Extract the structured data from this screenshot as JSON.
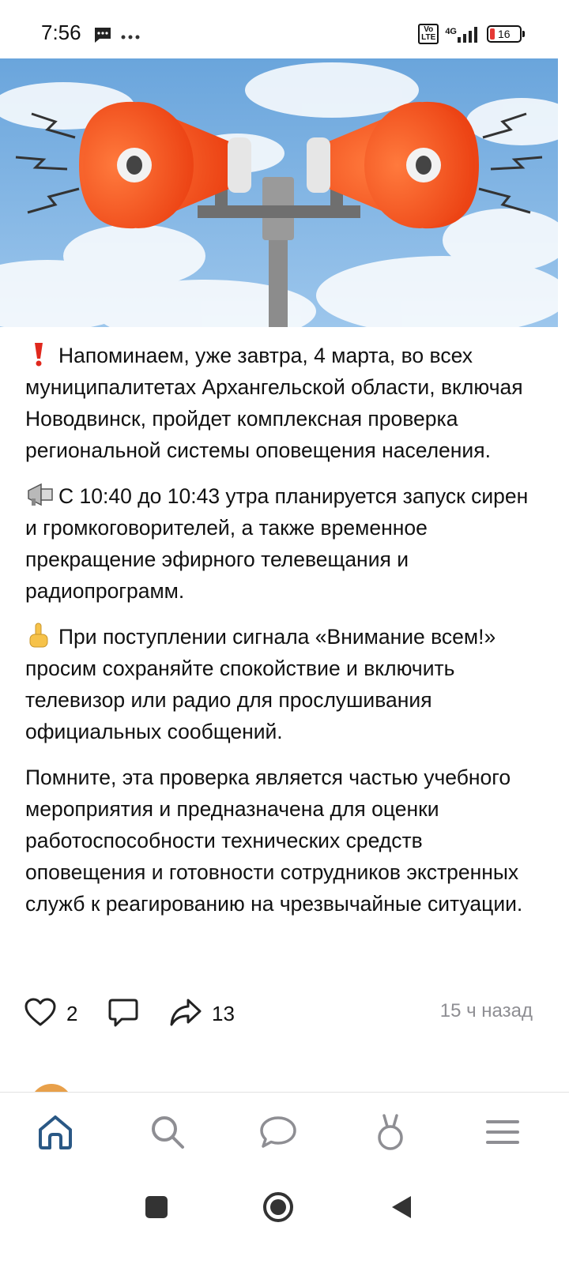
{
  "status_bar": {
    "time": "7:56",
    "icons": [
      "chat-notification-icon",
      "more-dots-icon",
      "volte-icon",
      "4g-signal-icon",
      "battery-icon"
    ],
    "volte_label": "Vo\nLTE",
    "network_label": "4G",
    "battery_level": "16"
  },
  "post": {
    "hero_image": "sirens-loudspeakers-illustration",
    "paragraphs": [
      {
        "emoji": "exclamation-icon",
        "text": "Напоминаем, уже завтра, 4 марта, во всех муниципалитетах Архангельской области, включая Новодвинск,  пройдет комплексная проверка региональной системы оповещения населения."
      },
      {
        "emoji": "loudspeaker-icon",
        "text": "С 10:40 до 10:43 утра планируется запуск сирен и громкоговорителей, а также временное прекращение эфирного телевещания и радиопрограмм."
      },
      {
        "emoji": "pointing-up-icon",
        "text": "При поступлении сигнала «Внимание всем!» просим сохраняйте спокойствие и включить телевизор или радио для прослушивания официальных сообщений."
      },
      {
        "emoji": "",
        "text": "Помните, эта проверка является частью учебного мероприятия и предназначена для оценки работоспособности технических средств оповещения и готовности сотрудников экстренных служб к реагированию на чрезвычайные ситуации."
      }
    ],
    "likes": "2",
    "shares": "13",
    "timestamp": "15 ч назад"
  },
  "bottom_nav": {
    "items": [
      "home-icon",
      "search-icon",
      "messages-icon",
      "clips-icon",
      "menu-icon"
    ],
    "active": "home-icon",
    "accent": "#2a5885"
  },
  "system_nav": [
    "recent-apps-icon",
    "home-circle-icon",
    "back-icon"
  ]
}
